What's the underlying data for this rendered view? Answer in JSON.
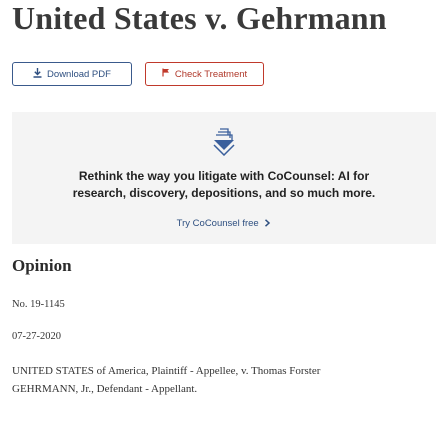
{
  "case": {
    "title": "United States v. Gehrmann"
  },
  "actions": {
    "download_label": "Download PDF",
    "check_label": "Check Treatment",
    "download_icon": "download-icon",
    "check_icon": "flag-icon"
  },
  "promo": {
    "icon": "layers-logo-icon",
    "line1": "Rethink the way you litigate with CoCounsel: AI for",
    "line2": "research, discovery, depositions, and so much more.",
    "link_label": "Try CoCounsel free",
    "link_icon": "chevron-right-icon"
  },
  "opinion": {
    "heading": "Opinion",
    "docket": "No. 19-1145",
    "date": "07-27-2020",
    "parties_line1": "UNITED STATES of America, Plaintiff - Appellee, v. Thomas Forster",
    "parties_line2": "GEHRMANN, Jr., Defendant - Appellant."
  },
  "colors": {
    "primary": "#2e4f80",
    "danger": "#c0392b",
    "promo_bg": "#f4f4f4"
  }
}
